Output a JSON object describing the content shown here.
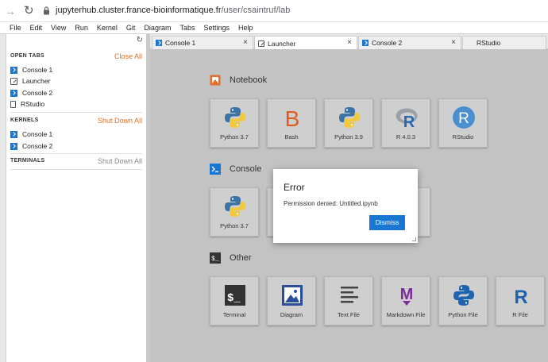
{
  "browser": {
    "url_host": "jupyterhub.cluster.france-bioinformatique.fr",
    "url_path": "/user/csaintruf/lab"
  },
  "menu": [
    "File",
    "Edit",
    "View",
    "Run",
    "Kernel",
    "Git",
    "Diagram",
    "Tabs",
    "Settings",
    "Help"
  ],
  "sidebar": {
    "open_tabs": {
      "title": "OPEN TABS",
      "action": "Close All",
      "items": [
        {
          "label": "Console 1",
          "icon": "console-icon"
        },
        {
          "label": "Launcher",
          "icon": "launcher-icon"
        },
        {
          "label": "Console 2",
          "icon": "console-icon"
        },
        {
          "label": "RStudio",
          "icon": "file-icon"
        }
      ]
    },
    "kernels": {
      "title": "KERNELS",
      "action": "Shut Down All",
      "items": [
        {
          "label": "Console 1",
          "icon": "console-icon"
        },
        {
          "label": "Console 2",
          "icon": "console-icon"
        }
      ]
    },
    "terminals": {
      "title": "TERMINALS",
      "action": "Shut Down All"
    }
  },
  "tabs": [
    {
      "label": "Console 1",
      "icon": "console-icon",
      "close": "×"
    },
    {
      "label": "Launcher",
      "icon": "launcher-icon",
      "close": "×"
    },
    {
      "label": "Console 2",
      "icon": "console-icon",
      "close": "×"
    },
    {
      "label": "RStudio",
      "icon": "",
      "close": ""
    }
  ],
  "launcher": {
    "notebook": {
      "title": "Notebook",
      "cards": [
        "Python 3.7",
        "Bash",
        "Python 3.9",
        "R 4.0.3",
        "RStudio"
      ]
    },
    "console": {
      "title": "Console",
      "cards": [
        "Python 3.7"
      ]
    },
    "other": {
      "title": "Other",
      "cards": [
        "Terminal",
        "Diagram",
        "Text File",
        "Markdown File",
        "Python File",
        "R File"
      ]
    }
  },
  "dialog": {
    "title": "Error",
    "message": "Permission denied: Untitled.ipynb",
    "button": "Dismiss"
  },
  "colors": {
    "accent_blue": "#1976d2",
    "orange": "#e0701f",
    "overlay_grey": "#c3c3c3"
  }
}
